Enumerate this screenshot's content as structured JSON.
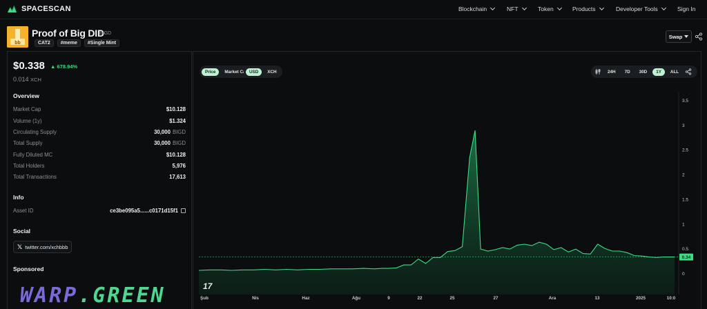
{
  "nav": {
    "brand": "SPACESCAN",
    "items": [
      {
        "label": "Blockchain",
        "dropdown": true
      },
      {
        "label": "NFT",
        "dropdown": true
      },
      {
        "label": "Token",
        "dropdown": true
      },
      {
        "label": "Products",
        "dropdown": true
      },
      {
        "label": "Developer Tools",
        "dropdown": true
      },
      {
        "label": "Sign In",
        "dropdown": false
      }
    ]
  },
  "token": {
    "name": "Proof of Big DID",
    "symbol": "BIGD",
    "tags": [
      "CAT2",
      "#meme",
      "#Single Mint"
    ],
    "swap_label": "Swap",
    "logo_color": "#f4b32a"
  },
  "price": {
    "usd": "$0.338",
    "change": "678.94%",
    "change_color": "#3ddc84",
    "xch_value": "0.014",
    "xch_unit": "XCH"
  },
  "overview": {
    "title": "Overview",
    "rows": [
      {
        "label": "Market Cap",
        "value": "$10.128",
        "unit": ""
      },
      {
        "label": "Volume (1y)",
        "value": "$1.324",
        "unit": ""
      },
      {
        "label": "Circulating Supply",
        "value": "30,000",
        "unit": "BIGD"
      },
      {
        "label": "Total Supply",
        "value": "30,000",
        "unit": "BIGD"
      },
      {
        "label": "Fully Diluted MC",
        "value": "$10.128",
        "unit": ""
      },
      {
        "label": "Total Holders",
        "value": "5,976",
        "unit": ""
      },
      {
        "label": "Total Transactions",
        "value": "17,613",
        "unit": ""
      }
    ]
  },
  "info": {
    "title": "Info",
    "asset_id_label": "Asset ID",
    "asset_id_value": "ce3be095a5......c0171d15f1"
  },
  "social": {
    "title": "Social",
    "twitter": "twitter.com/xchbbb"
  },
  "sponsored": {
    "title": "Sponsored",
    "logo_part1": "WARP",
    "logo_part2": ".GREEN"
  },
  "chart_controls": {
    "metric_toggle": [
      "Price",
      "Market Cap"
    ],
    "metric_active": "Price",
    "currency_toggle": [
      "USD",
      "XCH"
    ],
    "currency_active": "USD",
    "ranges": [
      "24H",
      "7D",
      "30D",
      "1Y",
      "ALL"
    ],
    "range_active": "1Y",
    "tv_logo": "17"
  },
  "chart_data": {
    "type": "area",
    "accent": "#3ddc84",
    "x_tick_labels": [
      "Şub",
      "Nis",
      "Haz",
      "Ağu",
      "9",
      "22",
      "25",
      "27",
      "Ara",
      "13",
      "2025",
      "10:0"
    ],
    "y_tick_labels": [
      "0",
      "0.5",
      "1",
      "1.5",
      "2",
      "2.5",
      "3",
      "3.5"
    ],
    "ylim": [
      0,
      3.5
    ],
    "current_value": 0.34,
    "current_label": "0.34",
    "points": [
      [
        0,
        0.07
      ],
      [
        0.03,
        0.08
      ],
      [
        0.06,
        0.08
      ],
      [
        0.09,
        0.07
      ],
      [
        0.12,
        0.08
      ],
      [
        0.15,
        0.08
      ],
      [
        0.18,
        0.09
      ],
      [
        0.21,
        0.08
      ],
      [
        0.24,
        0.09
      ],
      [
        0.27,
        0.08
      ],
      [
        0.3,
        0.09
      ],
      [
        0.33,
        0.09
      ],
      [
        0.36,
        0.1
      ],
      [
        0.39,
        0.1
      ],
      [
        0.42,
        0.1
      ],
      [
        0.45,
        0.11
      ],
      [
        0.48,
        0.1
      ],
      [
        0.5,
        0.11
      ],
      [
        0.52,
        0.11
      ],
      [
        0.54,
        0.12
      ],
      [
        0.56,
        0.18
      ],
      [
        0.58,
        0.18
      ],
      [
        0.6,
        0.3
      ],
      [
        0.62,
        0.21
      ],
      [
        0.64,
        0.33
      ],
      [
        0.66,
        0.33
      ],
      [
        0.68,
        0.45
      ],
      [
        0.7,
        0.47
      ],
      [
        0.72,
        0.55
      ],
      [
        0.74,
        2.35
      ],
      [
        0.755,
        2.9
      ],
      [
        0.77,
        0.5
      ],
      [
        0.79,
        0.46
      ],
      [
        0.81,
        0.49
      ],
      [
        0.83,
        0.53
      ],
      [
        0.85,
        0.5
      ],
      [
        0.87,
        0.58
      ],
      [
        0.89,
        0.6
      ],
      [
        0.91,
        0.57
      ],
      [
        0.93,
        0.64
      ],
      [
        0.95,
        0.6
      ],
      [
        0.97,
        0.49
      ],
      [
        0.99,
        0.53
      ],
      [
        1.01,
        0.44
      ],
      [
        1.03,
        0.5
      ],
      [
        1.05,
        0.41
      ],
      [
        1.07,
        0.4
      ],
      [
        1.09,
        0.6
      ],
      [
        1.11,
        0.51
      ],
      [
        1.13,
        0.46
      ],
      [
        1.15,
        0.46
      ],
      [
        1.17,
        0.43
      ],
      [
        1.19,
        0.37
      ],
      [
        1.21,
        0.36
      ],
      [
        1.23,
        0.34
      ],
      [
        1.25,
        0.33
      ],
      [
        1.27,
        0.34
      ],
      [
        1.29,
        0.34
      ],
      [
        1.3,
        0.34
      ]
    ]
  }
}
